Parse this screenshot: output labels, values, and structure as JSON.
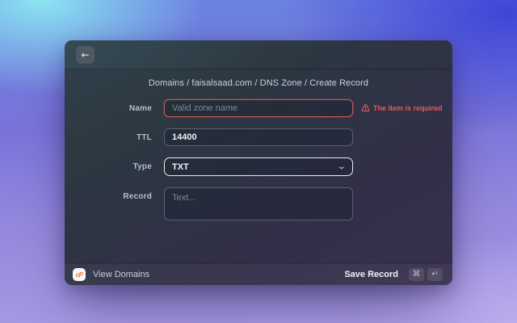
{
  "modal": {
    "breadcrumb": "Domains / faisalsaad.com / DNS Zone / Create Record"
  },
  "form": {
    "name": {
      "label": "Name",
      "value": "",
      "placeholder": "Valid zone name",
      "error": "The item is required"
    },
    "ttl": {
      "label": "TTL",
      "value": "14400"
    },
    "type": {
      "label": "Type",
      "value": "TXT"
    },
    "record": {
      "label": "Record",
      "value": "",
      "placeholder": "Text..."
    }
  },
  "footer": {
    "logo_text": "cP",
    "view_domains_label": "View Domains",
    "save_record_label": "Save Record",
    "keys": [
      "⌘",
      "↵"
    ]
  },
  "icons": {
    "back": "←",
    "chevron_down": "⌄"
  },
  "colors": {
    "error_red": "#e25c5c",
    "brand_orange": "#ff6c37",
    "bg_cyan": "#8deaf3",
    "bg_indigo": "#3e41d7",
    "bg_lavender": "#b7a9e8"
  }
}
